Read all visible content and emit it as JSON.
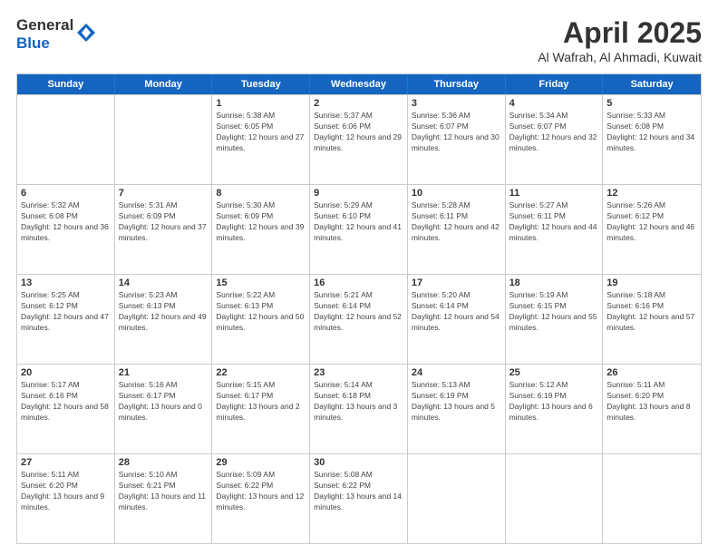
{
  "logo": {
    "general": "General",
    "blue": "Blue"
  },
  "title": "April 2025",
  "subtitle": "Al Wafrah, Al Ahmadi, Kuwait",
  "header_days": [
    "Sunday",
    "Monday",
    "Tuesday",
    "Wednesday",
    "Thursday",
    "Friday",
    "Saturday"
  ],
  "weeks": [
    [
      {
        "day": "",
        "info": ""
      },
      {
        "day": "",
        "info": ""
      },
      {
        "day": "1",
        "info": "Sunrise: 5:38 AM\nSunset: 6:05 PM\nDaylight: 12 hours and 27 minutes."
      },
      {
        "day": "2",
        "info": "Sunrise: 5:37 AM\nSunset: 6:06 PM\nDaylight: 12 hours and 29 minutes."
      },
      {
        "day": "3",
        "info": "Sunrise: 5:36 AM\nSunset: 6:07 PM\nDaylight: 12 hours and 30 minutes."
      },
      {
        "day": "4",
        "info": "Sunrise: 5:34 AM\nSunset: 6:07 PM\nDaylight: 12 hours and 32 minutes."
      },
      {
        "day": "5",
        "info": "Sunrise: 5:33 AM\nSunset: 6:08 PM\nDaylight: 12 hours and 34 minutes."
      }
    ],
    [
      {
        "day": "6",
        "info": "Sunrise: 5:32 AM\nSunset: 6:08 PM\nDaylight: 12 hours and 36 minutes."
      },
      {
        "day": "7",
        "info": "Sunrise: 5:31 AM\nSunset: 6:09 PM\nDaylight: 12 hours and 37 minutes."
      },
      {
        "day": "8",
        "info": "Sunrise: 5:30 AM\nSunset: 6:09 PM\nDaylight: 12 hours and 39 minutes."
      },
      {
        "day": "9",
        "info": "Sunrise: 5:29 AM\nSunset: 6:10 PM\nDaylight: 12 hours and 41 minutes."
      },
      {
        "day": "10",
        "info": "Sunrise: 5:28 AM\nSunset: 6:11 PM\nDaylight: 12 hours and 42 minutes."
      },
      {
        "day": "11",
        "info": "Sunrise: 5:27 AM\nSunset: 6:11 PM\nDaylight: 12 hours and 44 minutes."
      },
      {
        "day": "12",
        "info": "Sunrise: 5:26 AM\nSunset: 6:12 PM\nDaylight: 12 hours and 46 minutes."
      }
    ],
    [
      {
        "day": "13",
        "info": "Sunrise: 5:25 AM\nSunset: 6:12 PM\nDaylight: 12 hours and 47 minutes."
      },
      {
        "day": "14",
        "info": "Sunrise: 5:23 AM\nSunset: 6:13 PM\nDaylight: 12 hours and 49 minutes."
      },
      {
        "day": "15",
        "info": "Sunrise: 5:22 AM\nSunset: 6:13 PM\nDaylight: 12 hours and 50 minutes."
      },
      {
        "day": "16",
        "info": "Sunrise: 5:21 AM\nSunset: 6:14 PM\nDaylight: 12 hours and 52 minutes."
      },
      {
        "day": "17",
        "info": "Sunrise: 5:20 AM\nSunset: 6:14 PM\nDaylight: 12 hours and 54 minutes."
      },
      {
        "day": "18",
        "info": "Sunrise: 5:19 AM\nSunset: 6:15 PM\nDaylight: 12 hours and 55 minutes."
      },
      {
        "day": "19",
        "info": "Sunrise: 5:18 AM\nSunset: 6:16 PM\nDaylight: 12 hours and 57 minutes."
      }
    ],
    [
      {
        "day": "20",
        "info": "Sunrise: 5:17 AM\nSunset: 6:16 PM\nDaylight: 12 hours and 58 minutes."
      },
      {
        "day": "21",
        "info": "Sunrise: 5:16 AM\nSunset: 6:17 PM\nDaylight: 13 hours and 0 minutes."
      },
      {
        "day": "22",
        "info": "Sunrise: 5:15 AM\nSunset: 6:17 PM\nDaylight: 13 hours and 2 minutes."
      },
      {
        "day": "23",
        "info": "Sunrise: 5:14 AM\nSunset: 6:18 PM\nDaylight: 13 hours and 3 minutes."
      },
      {
        "day": "24",
        "info": "Sunrise: 5:13 AM\nSunset: 6:19 PM\nDaylight: 13 hours and 5 minutes."
      },
      {
        "day": "25",
        "info": "Sunrise: 5:12 AM\nSunset: 6:19 PM\nDaylight: 13 hours and 6 minutes."
      },
      {
        "day": "26",
        "info": "Sunrise: 5:11 AM\nSunset: 6:20 PM\nDaylight: 13 hours and 8 minutes."
      }
    ],
    [
      {
        "day": "27",
        "info": "Sunrise: 5:11 AM\nSunset: 6:20 PM\nDaylight: 13 hours and 9 minutes."
      },
      {
        "day": "28",
        "info": "Sunrise: 5:10 AM\nSunset: 6:21 PM\nDaylight: 13 hours and 11 minutes."
      },
      {
        "day": "29",
        "info": "Sunrise: 5:09 AM\nSunset: 6:22 PM\nDaylight: 13 hours and 12 minutes."
      },
      {
        "day": "30",
        "info": "Sunrise: 5:08 AM\nSunset: 6:22 PM\nDaylight: 13 hours and 14 minutes."
      },
      {
        "day": "",
        "info": ""
      },
      {
        "day": "",
        "info": ""
      },
      {
        "day": "",
        "info": ""
      }
    ]
  ]
}
